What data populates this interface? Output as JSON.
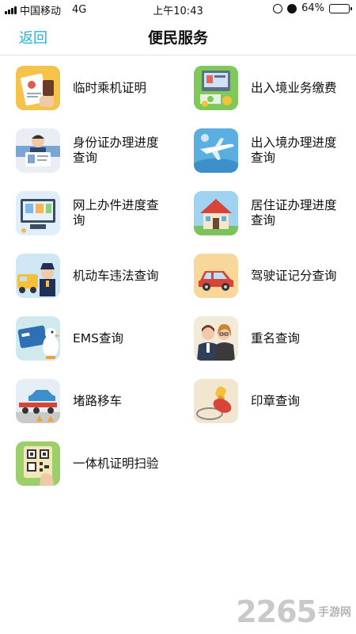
{
  "status_bar": {
    "carrier": "中国移动",
    "network": "4G",
    "time": "上午10:43",
    "battery_percent": 64,
    "battery_label": "64%"
  },
  "nav": {
    "back_label": "返回",
    "title": "便民服务"
  },
  "services": [
    {
      "label": "临时乘机证明",
      "icon": "boarding-certificate-icon"
    },
    {
      "label": "出入境业务缴费",
      "icon": "border-payment-icon"
    },
    {
      "label": "身份证办理进度查询",
      "icon": "id-card-progress-icon"
    },
    {
      "label": "出入境办理进度查询",
      "icon": "airplane-icon"
    },
    {
      "label": "网上办件进度查询",
      "icon": "online-case-icon"
    },
    {
      "label": "居住证办理进度查询",
      "icon": "house-icon"
    },
    {
      "label": "机动车违法查询",
      "icon": "traffic-police-icon"
    },
    {
      "label": "驾驶证记分查询",
      "icon": "car-icon"
    },
    {
      "label": "EMS查询",
      "icon": "ems-card-icon"
    },
    {
      "label": "重名查询",
      "icon": "people-icon"
    },
    {
      "label": "堵路移车",
      "icon": "tow-truck-icon"
    },
    {
      "label": "印章查询",
      "icon": "stamp-icon"
    },
    {
      "label": "一体机证明扫验",
      "icon": "qr-scan-icon"
    }
  ],
  "watermark": {
    "number": "2265",
    "text": "手游网"
  },
  "colors": {
    "accent": "#21b4d6",
    "divider": "#e3e3e3"
  }
}
